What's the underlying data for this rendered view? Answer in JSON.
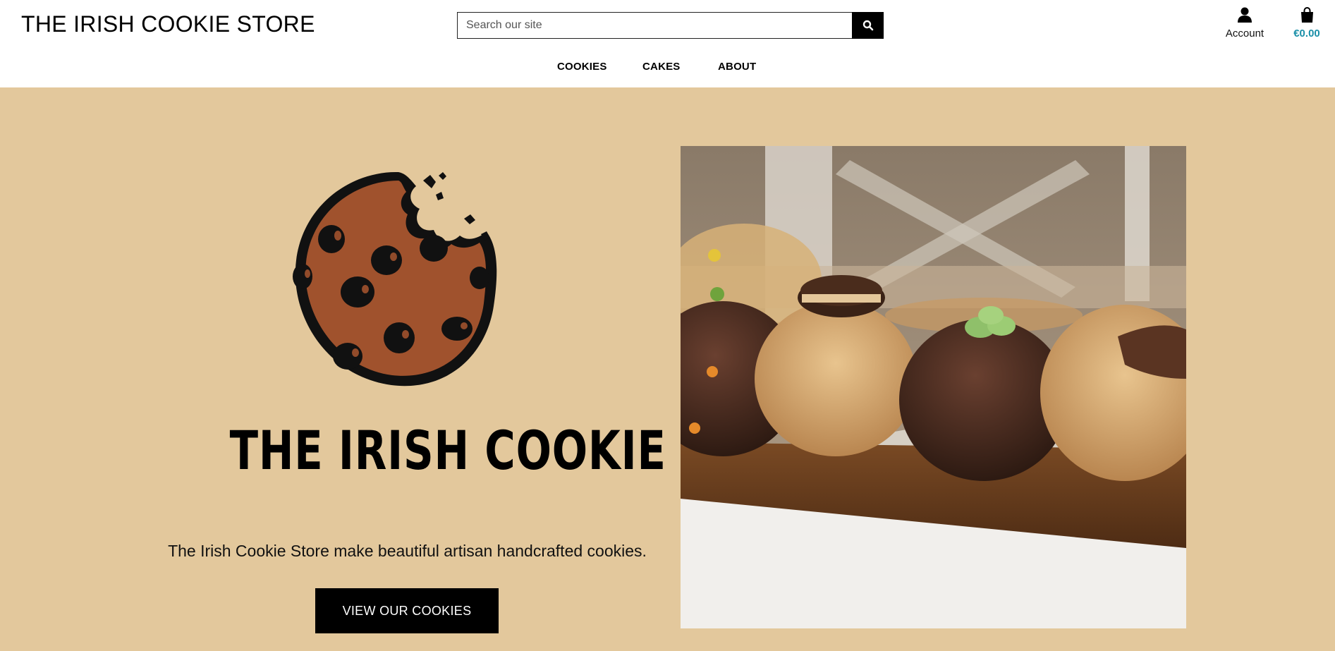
{
  "header": {
    "brand": "THE IRISH COOKIE STORE",
    "search_placeholder": "Search our site",
    "account_label": "Account",
    "bag_total": "€0.00"
  },
  "nav": {
    "items": [
      "COOKIES",
      "CAKES",
      "ABOUT"
    ]
  },
  "hero": {
    "logo_text": "THE IRISH COOKIE STORE",
    "tagline": "The Irish Cookie Store make beautiful artisan handcrafted cookies.",
    "cta_label": "VIEW OUR COOKIES"
  },
  "colors": {
    "hero_bg": "#e3c89c",
    "cookie": "#a0522d",
    "bag_total": "#1a8fa8"
  },
  "icons": [
    "search-icon",
    "user-icon",
    "shopping-bag-icon",
    "cookie-logo"
  ]
}
